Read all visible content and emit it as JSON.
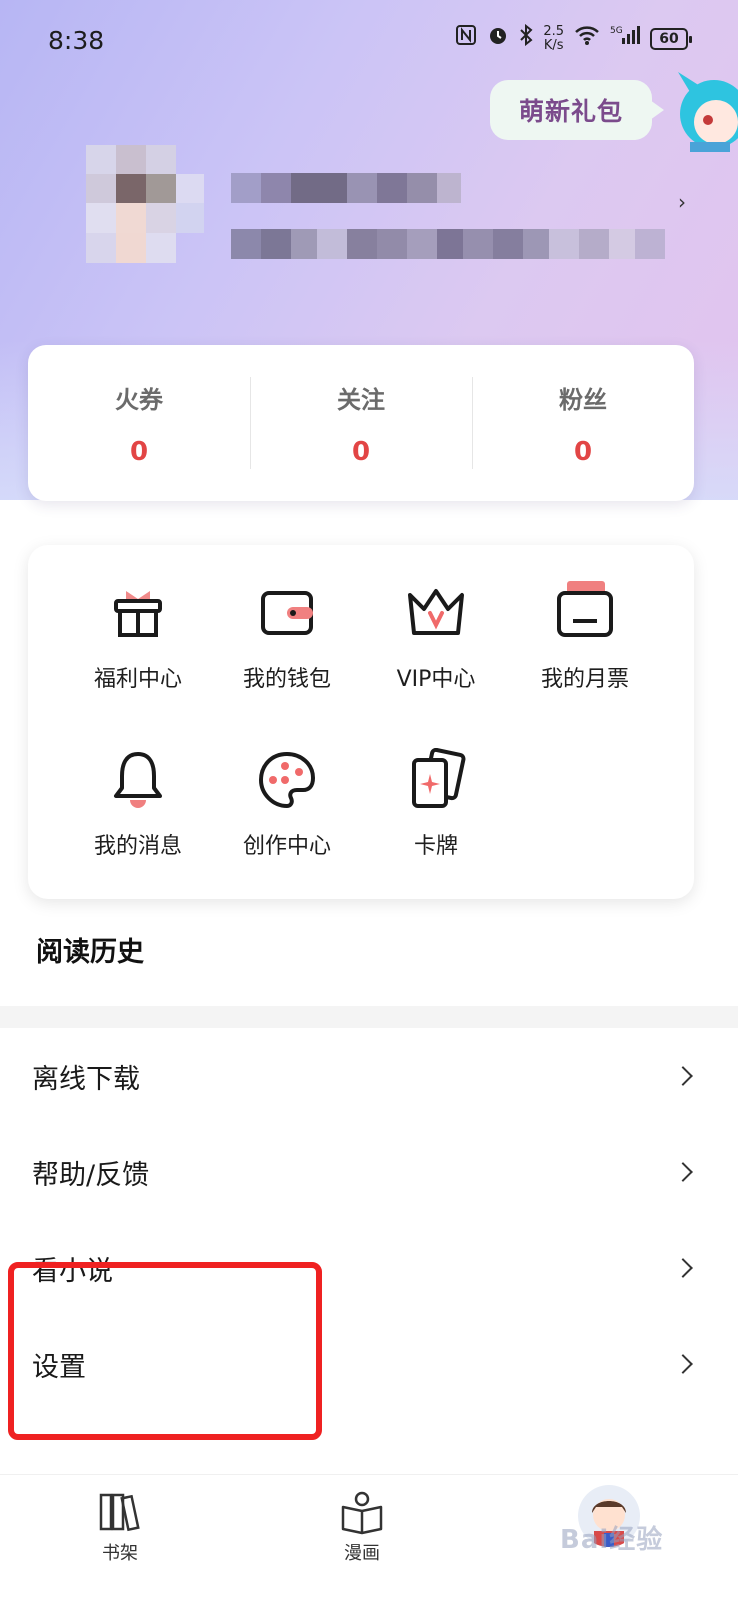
{
  "status_bar": {
    "time": "8:38",
    "speed_value": "2.5",
    "speed_unit": "K/s",
    "battery": "60",
    "icons": [
      "nfc-icon",
      "alarm-icon",
      "bluetooth-icon",
      "wifi-icon",
      "signal-5g-icon",
      "battery-icon"
    ]
  },
  "header": {
    "gift_label": "萌新礼包"
  },
  "stats": [
    {
      "label": "火券",
      "value": "0"
    },
    {
      "label": "关注",
      "value": "0"
    },
    {
      "label": "粉丝",
      "value": "0"
    }
  ],
  "grid": [
    {
      "label": "福利中心",
      "icon": "gift-icon"
    },
    {
      "label": "我的钱包",
      "icon": "wallet-icon"
    },
    {
      "label": "VIP中心",
      "icon": "crown-icon"
    },
    {
      "label": "我的月票",
      "icon": "ticket-icon"
    },
    {
      "label": "我的消息",
      "icon": "bell-icon"
    },
    {
      "label": "创作中心",
      "icon": "palette-icon"
    },
    {
      "label": "卡牌",
      "icon": "cards-icon"
    }
  ],
  "history": {
    "title": "阅读历史"
  },
  "menu": [
    {
      "label": "离线下载"
    },
    {
      "label": "帮助/反馈"
    },
    {
      "label": "看小说"
    },
    {
      "label": "设置"
    }
  ],
  "bottom_nav": [
    {
      "label": "书架",
      "icon": "bookshelf-icon"
    },
    {
      "label": "漫画",
      "icon": "open-book-icon"
    },
    {
      "label": "",
      "icon": "avatar-icon"
    }
  ],
  "watermark": "Bai经验",
  "colors": {
    "accent_red": "#e24545",
    "highlight_red": "#ef2121",
    "gift_text": "#7b4b8c"
  }
}
